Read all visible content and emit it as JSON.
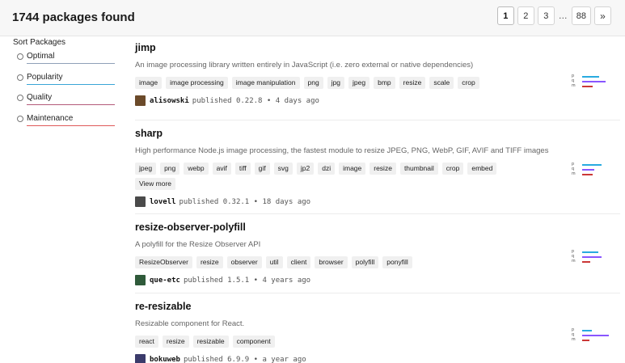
{
  "header": {
    "result_count": "1744 packages found",
    "pages": [
      "1",
      "2",
      "3",
      "88"
    ],
    "ellipsis": "…",
    "next": "»"
  },
  "sort": {
    "title": "Sort Packages",
    "options": [
      {
        "label": "Optimal",
        "color": "#8fa0b8"
      },
      {
        "label": "Popularity",
        "color": "#3aa6d6"
      },
      {
        "label": "Quality",
        "color": "#b35a7a"
      },
      {
        "label": "Maintenance",
        "color": "#e05a5a"
      }
    ]
  },
  "colors": {
    "popularity": "#29abe0",
    "quality": "#8956ff",
    "maintenance": "#cb3837"
  },
  "packages": [
    {
      "name": "jimp",
      "description": "An image processing library written entirely in JavaScript (i.e. zero external or native dependencies)",
      "tags": [
        "image",
        "image processing",
        "image manipulation",
        "png",
        "jpg",
        "jpeg",
        "bmp",
        "resize",
        "scale",
        "crop"
      ],
      "view_more": "",
      "publisher": "alisowski",
      "published_info": "published 0.22.8 • 4 days ago",
      "avatar_color": "#6b4a2a",
      "score_labels": [
        "p",
        "q",
        "m"
      ],
      "scores": {
        "p": 0.62,
        "q": 0.85,
        "m": 0.38
      }
    },
    {
      "name": "sharp",
      "description": "High performance Node.js image processing, the fastest module to resize JPEG, PNG, WebP, GIF, AVIF and TIFF images",
      "tags": [
        "jpeg",
        "png",
        "webp",
        "avif",
        "tiff",
        "gif",
        "svg",
        "jp2",
        "dzi",
        "image",
        "resize",
        "thumbnail",
        "crop",
        "embed"
      ],
      "view_more": "View more",
      "publisher": "lovell",
      "published_info": "published 0.32.1 • 18 days ago",
      "avatar_color": "#4a4a4a",
      "score_labels": [
        "p",
        "q",
        "m"
      ],
      "scores": {
        "p": 0.7,
        "q": 0.45,
        "m": 0.38
      }
    },
    {
      "name": "resize-observer-polyfill",
      "description": "A polyfill for the Resize Observer API",
      "tags": [
        "ResizeObserver",
        "resize",
        "observer",
        "util",
        "client",
        "browser",
        "polyfill",
        "ponyfill"
      ],
      "view_more": "",
      "publisher": "que-etc",
      "published_info": "published 1.5.1 • 4 years ago",
      "avatar_color": "#2f5a3a",
      "score_labels": [
        "p",
        "q",
        "m"
      ],
      "scores": {
        "p": 0.58,
        "q": 0.72,
        "m": 0.28
      }
    },
    {
      "name": "re-resizable",
      "description": "Resizable component for React.",
      "tags": [
        "react",
        "resize",
        "resizable",
        "component"
      ],
      "view_more": "",
      "publisher": "bokuweb",
      "published_info": "published 6.9.9 • a year ago",
      "avatar_color": "#3b3b6b",
      "score_labels": [
        "p",
        "q",
        "m"
      ],
      "scores": {
        "p": 0.35,
        "q": 0.98,
        "m": 0.25
      }
    }
  ]
}
